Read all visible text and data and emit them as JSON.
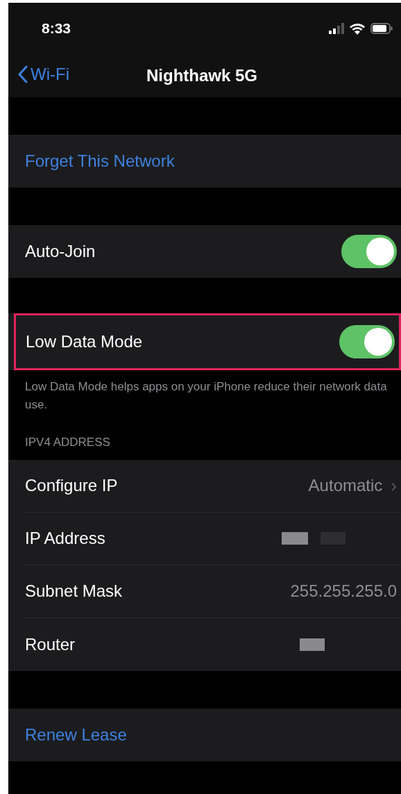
{
  "status_bar": {
    "time": "8:33"
  },
  "nav": {
    "back": "Wi-Fi",
    "title": "Nighthawk 5G"
  },
  "sections": [
    {
      "rows": [
        {
          "kind": "action",
          "label": "Forget This Network"
        }
      ]
    },
    {
      "rows": [
        {
          "kind": "toggle",
          "label": "Auto-Join",
          "on": true,
          "highlighted": false
        }
      ]
    },
    {
      "rows": [
        {
          "kind": "toggle",
          "label": "Low Data Mode",
          "on": true,
          "highlighted": true
        }
      ],
      "footer": "Low Data Mode helps apps on your iPhone reduce their network data use."
    },
    {
      "header": "IPV4 ADDRESS",
      "rows": [
        {
          "kind": "detail",
          "label": "Configure IP",
          "value": "Automatic",
          "chevron": "›"
        },
        {
          "kind": "redacted",
          "label": "IP Address"
        },
        {
          "kind": "value",
          "label": "Subnet Mask",
          "value": "255.255.255.0"
        },
        {
          "kind": "redacted_short",
          "label": "Router"
        }
      ]
    },
    {
      "rows": [
        {
          "kind": "action",
          "label": "Renew Lease"
        }
      ]
    }
  ]
}
